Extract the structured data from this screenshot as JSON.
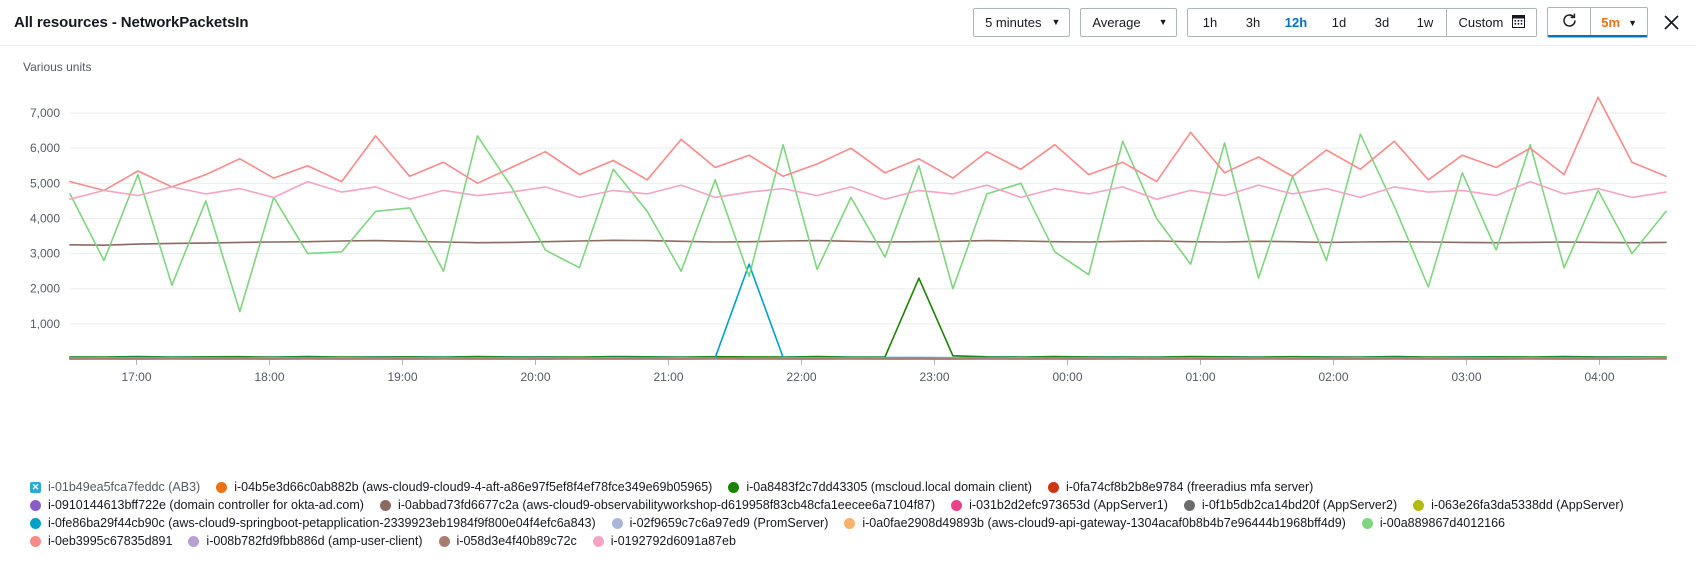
{
  "header": {
    "title": "All resources - NetworkPacketsIn",
    "period": {
      "label": "5 minutes",
      "caret": "▼"
    },
    "statistic": {
      "label": "Average",
      "caret": "▼"
    },
    "ranges": [
      {
        "label": "1h",
        "active": false
      },
      {
        "label": "3h",
        "active": false
      },
      {
        "label": "12h",
        "active": true
      },
      {
        "label": "1d",
        "active": false
      },
      {
        "label": "3d",
        "active": false
      },
      {
        "label": "1w",
        "active": false
      }
    ],
    "custom": {
      "label": "Custom",
      "icon": "calendar-icon"
    },
    "refresh": {
      "icon": "refresh-icon",
      "interval": "5m",
      "caret": "▼"
    },
    "close": {
      "icon": "close-icon",
      "glyph": "✕"
    }
  },
  "chart_data": {
    "type": "line",
    "title": "All resources - NetworkPacketsIn",
    "ylabel": "Various units",
    "xlabel": "",
    "ylim": [
      0,
      7600
    ],
    "yticks": [
      "1,000",
      "2,000",
      "3,000",
      "4,000",
      "5,000",
      "6,000",
      "7,000"
    ],
    "ytick_values": [
      1000,
      2000,
      3000,
      4000,
      5000,
      6000,
      7000
    ],
    "xticks": [
      "17:00",
      "18:00",
      "19:00",
      "20:00",
      "21:00",
      "22:00",
      "23:00",
      "00:00",
      "01:00",
      "02:00",
      "03:00",
      "04:00"
    ],
    "grid": true,
    "legend_position": "bottom",
    "series": [
      {
        "name": "i-01b49ea5fca7feddc (AB3)",
        "color": "#2ea8d4",
        "disabled": true,
        "values": []
      },
      {
        "name": "i-04b5e3d66c0ab882b (aws-cloud9-cloud9-4-aft-a86e97f5ef8f4ef78fce349e69b05965)",
        "color": "#ec7211",
        "values": [
          0,
          0,
          0,
          0,
          0,
          0,
          0,
          0,
          0,
          0,
          0,
          0,
          0,
          0,
          0,
          0,
          0,
          0,
          0,
          0,
          0,
          0,
          0,
          0,
          0,
          0,
          0,
          0,
          0,
          0,
          0,
          0,
          0,
          0,
          0,
          0,
          0,
          0,
          0,
          0,
          0,
          0,
          0,
          0,
          0,
          0,
          0,
          0
        ]
      },
      {
        "name": "i-0a8483f2c7dd43305 (mscloud.local domain client)",
        "color": "#1d8102",
        "values": [
          60,
          55,
          70,
          58,
          62,
          66,
          54,
          72,
          58,
          60,
          64,
          57,
          68,
          59,
          61,
          55,
          70,
          63,
          58,
          66,
          60,
          54,
          72,
          58,
          61,
          2300,
          90,
          64,
          57,
          68,
          59,
          61,
          55,
          70,
          63,
          58,
          66,
          60,
          54,
          72,
          58,
          60,
          64,
          57,
          68,
          59,
          61,
          55
        ]
      },
      {
        "name": "i-0fa74cf8b2b8e9784 (freeradius mfa server)",
        "color": "#d13212",
        "values": [
          30,
          28,
          32,
          29,
          31,
          27,
          33,
          30,
          28,
          32,
          29,
          31,
          27,
          33,
          30,
          28,
          32,
          29,
          31,
          27,
          33,
          30,
          28,
          32,
          29,
          31,
          27,
          33,
          30,
          28,
          32,
          29,
          31,
          27,
          33,
          30,
          28,
          32,
          29,
          31,
          27,
          33,
          30,
          28,
          32,
          29,
          31,
          27
        ]
      },
      {
        "name": "i-0910144613bff722e (domain controller for okta-ad.com)",
        "color": "#8b5cc7",
        "values": [
          12,
          14,
          11,
          13,
          12,
          15,
          11,
          14,
          12,
          13,
          11,
          15,
          12,
          14,
          11,
          13,
          12,
          15,
          11,
          14,
          12,
          13,
          11,
          15,
          12,
          14,
          11,
          13,
          12,
          15,
          11,
          14,
          12,
          13,
          11,
          15,
          12,
          14,
          11,
          13,
          12,
          15,
          11,
          14,
          12,
          13,
          11,
          15
        ]
      },
      {
        "name": "i-0abbad73fd6677c2a (aws-cloud9-observabilityworkshop-d619958f83cb48cfa1eecee6a7104f87)",
        "color": "#8b6b61",
        "values": [
          3250,
          3240,
          3270,
          3290,
          3300,
          3320,
          3330,
          3340,
          3360,
          3370,
          3350,
          3330,
          3310,
          3320,
          3340,
          3360,
          3380,
          3370,
          3350,
          3330,
          3340,
          3360,
          3370,
          3350,
          3330,
          3340,
          3350,
          3370,
          3360,
          3340,
          3330,
          3350,
          3360,
          3340,
          3330,
          3350,
          3340,
          3320,
          3330,
          3340,
          3330,
          3320,
          3310,
          3320,
          3330,
          3320,
          3310,
          3320
        ]
      },
      {
        "name": "i-031b2d2efc973653d (AppServer1)",
        "color": "#e9408a",
        "values": [
          8,
          9,
          7,
          10,
          8,
          9,
          7,
          10,
          8,
          9,
          7,
          10,
          8,
          9,
          7,
          10,
          8,
          9,
          7,
          10,
          8,
          9,
          7,
          10,
          8,
          9,
          7,
          10,
          8,
          9,
          7,
          10,
          8,
          9,
          7,
          10,
          8,
          9,
          7,
          10,
          8,
          9,
          7,
          10,
          8,
          9,
          7,
          10
        ]
      },
      {
        "name": "i-0f1b5db2ca14bd20f (AppServer2)",
        "color": "#6b6b6b",
        "values": [
          6,
          7,
          5,
          8,
          6,
          7,
          5,
          8,
          6,
          7,
          5,
          8,
          6,
          7,
          5,
          8,
          6,
          7,
          5,
          8,
          6,
          7,
          5,
          8,
          6,
          7,
          5,
          8,
          6,
          7,
          5,
          8,
          6,
          7,
          5,
          8,
          6,
          7,
          5,
          8,
          6,
          7,
          5,
          8,
          6,
          7,
          5,
          8
        ]
      },
      {
        "name": "i-063e26fa3da5338dd (AppServer)",
        "color": "#b5b811",
        "values": [
          5,
          6,
          4,
          7,
          5,
          6,
          4,
          7,
          5,
          6,
          4,
          7,
          5,
          6,
          4,
          7,
          5,
          6,
          4,
          7,
          5,
          6,
          4,
          7,
          5,
          6,
          4,
          7,
          5,
          6,
          4,
          7,
          5,
          6,
          4,
          7,
          5,
          6,
          4,
          7,
          5,
          6,
          4,
          7,
          5,
          6,
          4,
          7
        ]
      },
      {
        "name": "i-0fe86ba29f44cb90c (aws-cloud9-springboot-petapplication-2339923eb1984f9f800e04f4efc6a843)",
        "color": "#00a1c9",
        "values": [
          40,
          38,
          42,
          39,
          41,
          37,
          43,
          40,
          38,
          42,
          39,
          41,
          37,
          43,
          40,
          38,
          42,
          39,
          41,
          37,
          2700,
          45,
          38,
          42,
          39,
          41,
          37,
          43,
          40,
          38,
          42,
          39,
          41,
          37,
          43,
          40,
          38,
          42,
          39,
          41,
          37,
          43,
          40,
          38,
          42,
          39,
          41,
          37
        ]
      },
      {
        "name": "i-02f9659c7c6a97ed9 (PromServer)",
        "color": "#aab7d8",
        "values": [
          20,
          22,
          19,
          23,
          21,
          20,
          22,
          19,
          23,
          21,
          20,
          22,
          19,
          23,
          21,
          20,
          22,
          19,
          23,
          21,
          20,
          22,
          19,
          23,
          21,
          20,
          22,
          19,
          23,
          21,
          20,
          22,
          19,
          23,
          21,
          20,
          22,
          19,
          23,
          21,
          20,
          22,
          19,
          23,
          21,
          20,
          22,
          19
        ]
      },
      {
        "name": "i-0a0fae2908d49893b (aws-cloud9-api-gateway-1304acaf0b8b4b7e96444b1968bff4d9)",
        "color": "#f5b36a",
        "values": [
          15,
          16,
          14,
          17,
          15,
          16,
          14,
          17,
          15,
          16,
          14,
          17,
          15,
          16,
          14,
          17,
          15,
          16,
          14,
          17,
          15,
          16,
          14,
          17,
          15,
          16,
          14,
          17,
          15,
          16,
          14,
          17,
          15,
          16,
          14,
          17,
          15,
          16,
          14,
          17,
          15,
          16,
          14,
          17,
          15,
          16,
          14,
          17
        ]
      },
      {
        "name": "i-00a889867d4012166",
        "color": "#7fd47f",
        "values": [
          4700,
          2800,
          5250,
          2100,
          4500,
          1350,
          4600,
          3000,
          3050,
          4200,
          4300,
          2500,
          6350,
          4900,
          3100,
          2600,
          5400,
          4200,
          2500,
          5100,
          2350,
          6100,
          2550,
          4600,
          2900,
          5500,
          2000,
          4700,
          5000,
          3050,
          2400,
          6200,
          4000,
          2700,
          6150,
          2300,
          5200,
          2800,
          6400,
          4350,
          2050,
          5300,
          3100,
          6100,
          2600,
          4800,
          3000,
          4200
        ]
      },
      {
        "name": "i-0eb3995c67835d891",
        "color": "#f98a8a",
        "values": [
          5050,
          4800,
          5350,
          4900,
          5250,
          5700,
          5150,
          5500,
          5050,
          6350,
          5200,
          5600,
          5000,
          5450,
          5900,
          5250,
          5650,
          5100,
          6250,
          5450,
          5800,
          5200,
          5550,
          6000,
          5300,
          5700,
          5150,
          5900,
          5400,
          6100,
          5250,
          5600,
          5050,
          6450,
          5300,
          5750,
          5200,
          5950,
          5400,
          6200,
          5100,
          5800,
          5450,
          6000,
          5250,
          7450,
          5600,
          5200
        ]
      },
      {
        "name": "i-008b782fd9fbb886d (amp-user-client)",
        "color": "#b8a0d4",
        "values": [
          10,
          11,
          9,
          12,
          10,
          11,
          9,
          12,
          10,
          11,
          9,
          12,
          10,
          11,
          9,
          12,
          10,
          11,
          9,
          12,
          10,
          11,
          9,
          12,
          10,
          11,
          9,
          12,
          10,
          11,
          9,
          12,
          10,
          11,
          9,
          12,
          10,
          11,
          9,
          12,
          10,
          11,
          9,
          12,
          10,
          11,
          9,
          12
        ]
      },
      {
        "name": "i-058d3e4f40b89c72c",
        "color": "#a87c70",
        "values": [
          7,
          8,
          6,
          9,
          7,
          8,
          6,
          9,
          7,
          8,
          6,
          9,
          7,
          8,
          6,
          9,
          7,
          8,
          6,
          9,
          7,
          8,
          6,
          9,
          7,
          8,
          6,
          9,
          7,
          8,
          6,
          9,
          7,
          8,
          6,
          9,
          7,
          8,
          6,
          9,
          7,
          8,
          6,
          9,
          7,
          8,
          6,
          9
        ]
      },
      {
        "name": "i-0192792d6091a87eb",
        "color": "#f5a3c7",
        "values": [
          4550,
          4800,
          4650,
          4900,
          4700,
          4850,
          4600,
          5050,
          4750,
          4900,
          4550,
          4800,
          4650,
          4750,
          4900,
          4600,
          4800,
          4700,
          4950,
          4600,
          4750,
          4850,
          4650,
          4900,
          4550,
          4800,
          4700,
          4950,
          4600,
          4850,
          4700,
          4900,
          4550,
          4800,
          4650,
          4950,
          4700,
          4850,
          4600,
          4900,
          4750,
          4800,
          4650,
          5050,
          4700,
          4850,
          4600,
          4750
        ]
      }
    ]
  }
}
